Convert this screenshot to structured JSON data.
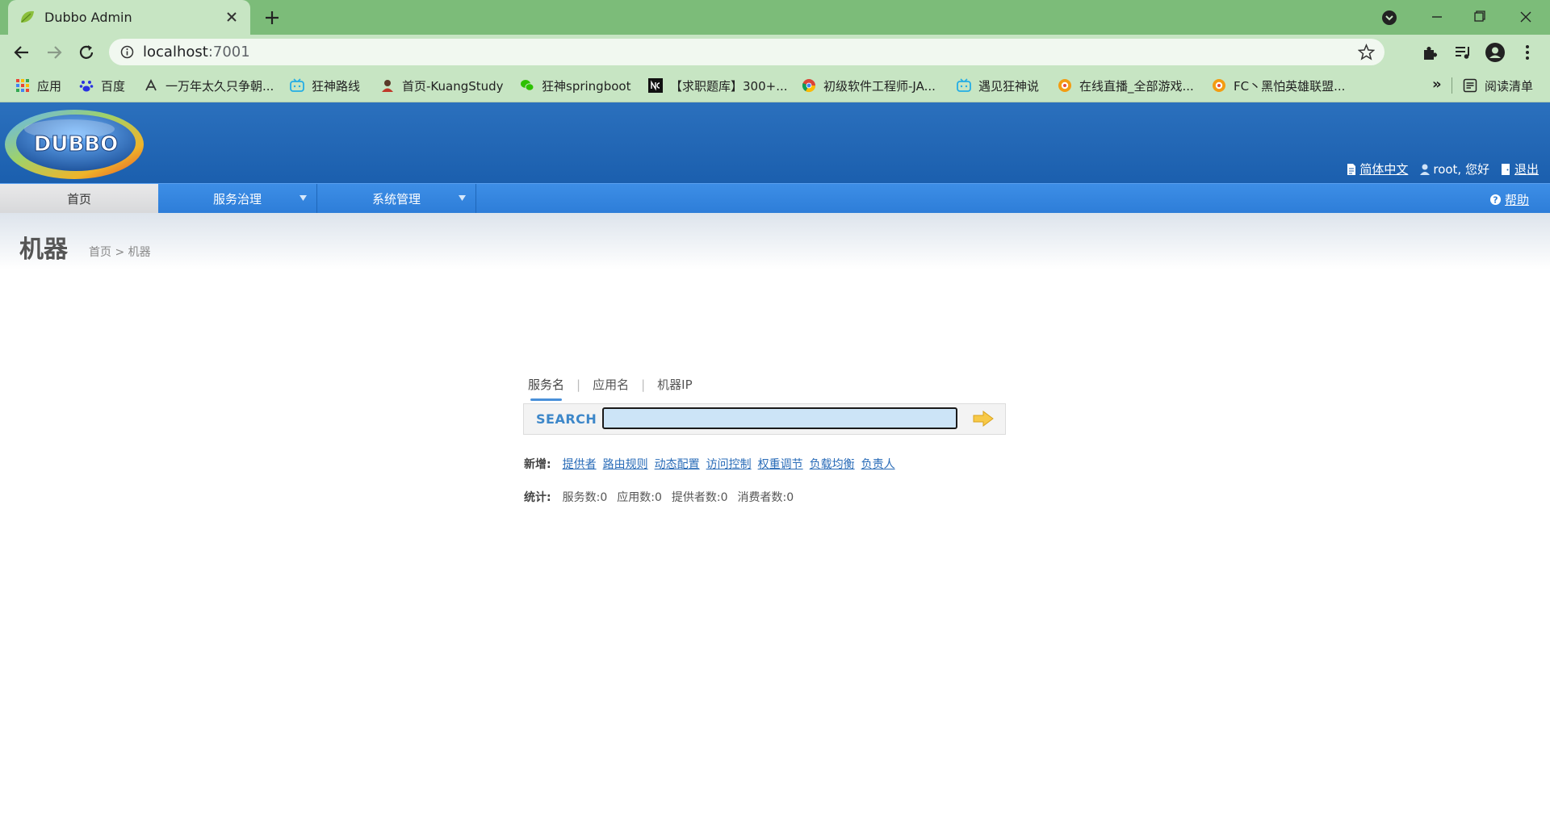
{
  "browser": {
    "tab_title": "Dubbo Admin",
    "url_host": "localhost",
    "url_port": ":7001",
    "bookmarks": [
      {
        "label": "应用",
        "icon": "apps-grid-icon"
      },
      {
        "label": "百度",
        "icon": "baidu-paw-icon"
      },
      {
        "label": "一万年太久只争朝...",
        "icon": "bookmark-site-icon"
      },
      {
        "label": "狂神路线",
        "icon": "bilibili-icon"
      },
      {
        "label": "首页-KuangStudy",
        "icon": "avatar-site-icon"
      },
      {
        "label": "狂神springboot",
        "icon": "wechat-icon"
      },
      {
        "label": "【求职题库】300+...",
        "icon": "nc-site-icon"
      },
      {
        "label": "初级软件工程师-JA...",
        "icon": "chrome-site-icon"
      },
      {
        "label": "遇见狂神说",
        "icon": "bilibili-icon"
      },
      {
        "label": "在线直播_全部游戏...",
        "icon": "live-site-icon"
      },
      {
        "label": "FC丶黑怕英雄联盟...",
        "icon": "live-site-icon"
      }
    ],
    "more_bookmarks": "»",
    "reading_list": "阅读清单"
  },
  "header": {
    "logo_text": "DUBBO",
    "lang_link": "简体中文",
    "greeting": "root, 您好",
    "logout": "退出"
  },
  "nav": {
    "home": "首页",
    "service_gov": "服务治理",
    "sys_mgmt": "系统管理",
    "help": "帮助"
  },
  "page": {
    "title": "机器",
    "crumb_home": "首页",
    "crumb_sep": " > ",
    "crumb_current": "机器"
  },
  "search": {
    "tabs": [
      "服务名",
      "应用名",
      "机器IP"
    ],
    "tab_sep": "|",
    "label": "SEARCH",
    "value": ""
  },
  "add": {
    "label": "新增:",
    "links": [
      "提供者",
      "路由规则",
      "动态配置",
      "访问控制",
      "权重调节",
      "负载均衡",
      "负责人"
    ]
  },
  "stats": {
    "label": "统计:",
    "items": [
      "服务数:0",
      "应用数:0",
      "提供者数:0",
      "消费者数:0"
    ]
  },
  "colors": {
    "header_blue": "#1b5fae",
    "nav_blue": "#2d7dd8",
    "link_blue": "#2a6cb8",
    "tab_green": "#7cbc79"
  }
}
